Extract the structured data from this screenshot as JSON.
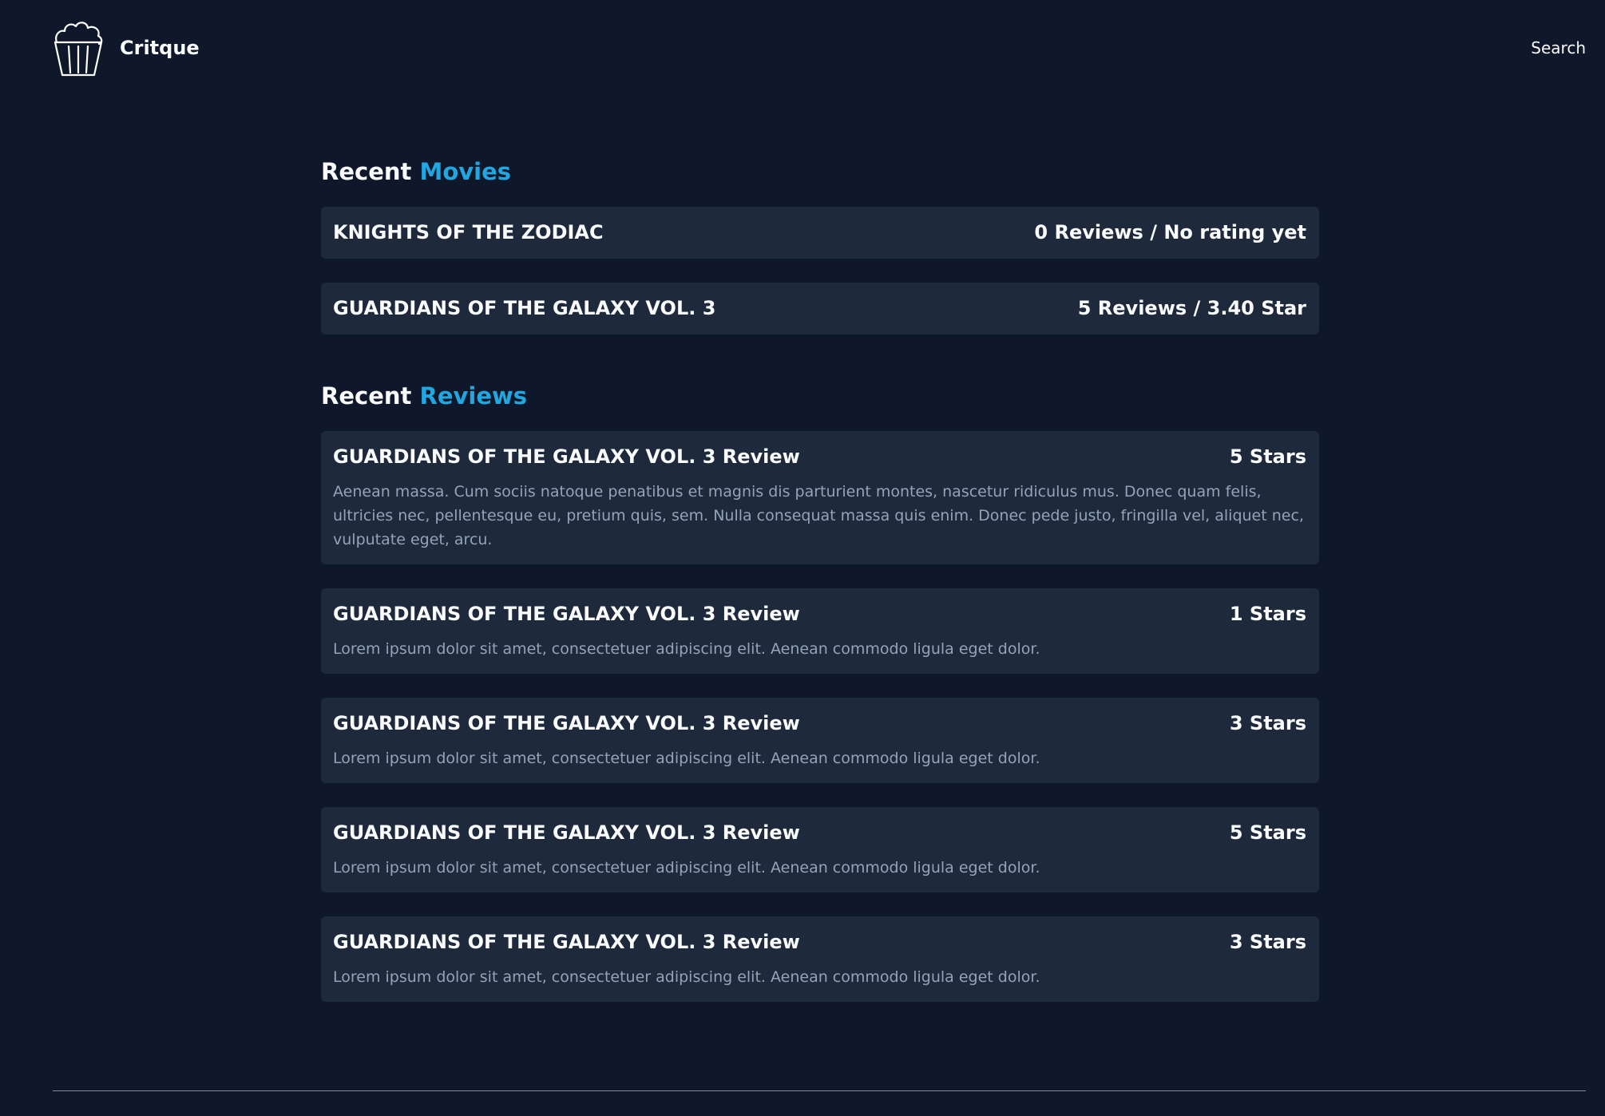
{
  "header": {
    "brand": "Critque",
    "logo_icon": "popcorn-icon",
    "search_label": "Search"
  },
  "movies_section": {
    "title_prefix": "Recent",
    "title_accent": "Movies",
    "items": [
      {
        "title": "KNIGHTS OF THE ZODIAC",
        "meta": "0 Reviews / No rating yet"
      },
      {
        "title": "GUARDIANS OF THE GALAXY VOL. 3",
        "meta": "5 Reviews / 3.40 Star"
      }
    ]
  },
  "reviews_section": {
    "title_prefix": "Recent",
    "title_accent": "Reviews",
    "items": [
      {
        "title": "GUARDIANS OF THE GALAXY VOL. 3 Review",
        "stars": "5 Stars",
        "body": "Aenean massa. Cum sociis natoque penatibus et magnis dis parturient montes, nascetur ridiculus mus. Donec quam felis, ultricies nec, pellentesque eu, pretium quis, sem. Nulla consequat massa quis enim. Donec pede justo, fringilla vel, aliquet nec, vulputate eget, arcu."
      },
      {
        "title": "GUARDIANS OF THE GALAXY VOL. 3 Review",
        "stars": "1 Stars",
        "body": "Lorem ipsum dolor sit amet, consectetuer adipiscing elit. Aenean commodo ligula eget dolor."
      },
      {
        "title": "GUARDIANS OF THE GALAXY VOL. 3 Review",
        "stars": "3 Stars",
        "body": "Lorem ipsum dolor sit amet, consectetuer adipiscing elit. Aenean commodo ligula eget dolor."
      },
      {
        "title": "GUARDIANS OF THE GALAXY VOL. 3 Review",
        "stars": "5 Stars",
        "body": "Lorem ipsum dolor sit amet, consectetuer adipiscing elit. Aenean commodo ligula eget dolor."
      },
      {
        "title": "GUARDIANS OF THE GALAXY VOL. 3 Review",
        "stars": "3 Stars",
        "body": "Lorem ipsum dolor sit amet, consectetuer adipiscing elit. Aenean commodo ligula eget dolor."
      }
    ]
  },
  "colors": {
    "background": "#0f172a",
    "card": "#1e293b",
    "accent": "#22a6df",
    "muted_text": "#94a3b8"
  }
}
